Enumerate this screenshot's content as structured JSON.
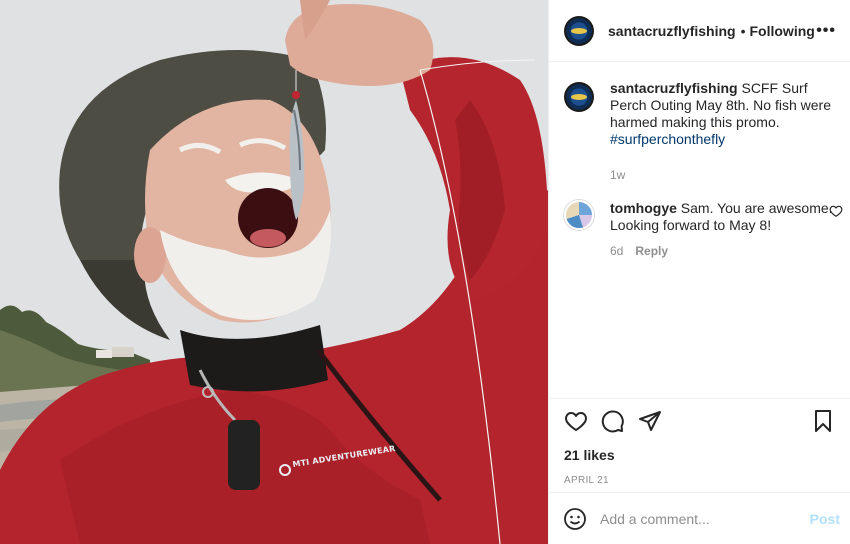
{
  "photo": {
    "description_icon": "fisherman-photo",
    "jacket_brand": "MTI ADVENTUREWEAR"
  },
  "header": {
    "username": "santacruzflyfishing",
    "separator": "•",
    "follow_label": "Following",
    "more_icon": "more-dots-icon",
    "more_label": "•••"
  },
  "caption": {
    "username": "santacruzflyfishing",
    "text": "SCFF Surf Perch Outing May 8th. No fish were harmed making this promo.",
    "hashtag": "#surfperchonthefly",
    "age": "1w"
  },
  "comments": [
    {
      "username": "tomhogye",
      "text": "Sam. You are awesome. Looking forward to May 8!",
      "age": "6d",
      "reply_label": "Reply"
    }
  ],
  "actions": {
    "likes": "21 likes",
    "date": "APRIL 21"
  },
  "add_comment": {
    "placeholder": "Add a comment...",
    "post_label": "Post"
  },
  "colors": {
    "hashtag": "#00376b",
    "post_button_disabled": "#b2dffc",
    "meta_text": "#8e8e8e",
    "jacket_red": "#b3242c"
  }
}
